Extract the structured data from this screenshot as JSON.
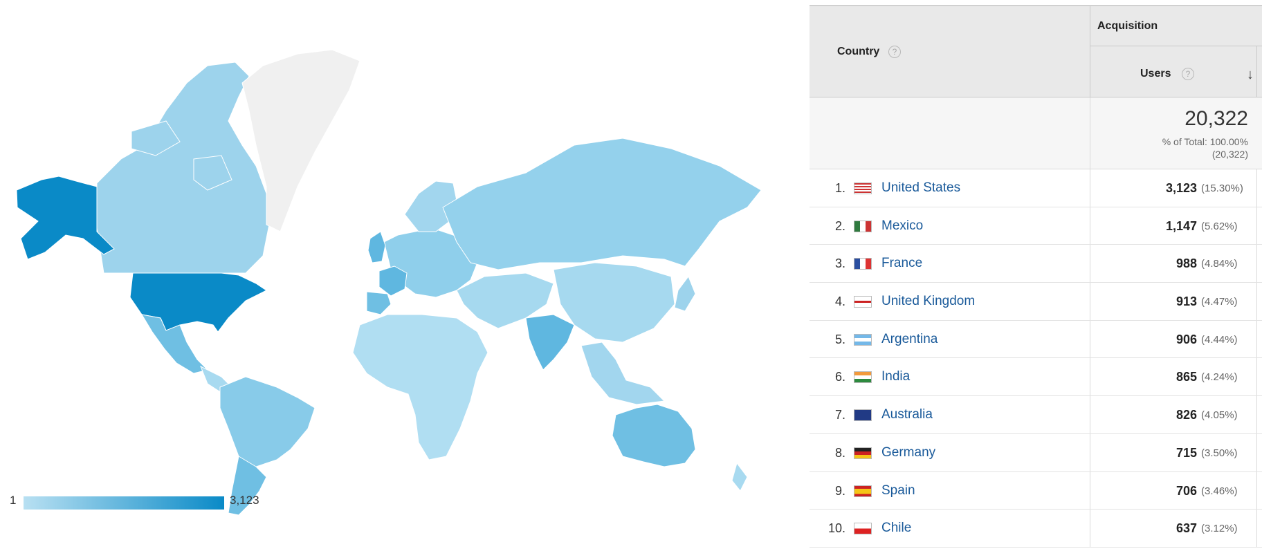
{
  "legend": {
    "min": "1",
    "max": "3,123",
    "color_low": "#b8e0f2",
    "color_high": "#0a8ac7"
  },
  "map_regions": [
    {
      "name": "Canada",
      "color": "#9dd3ec"
    },
    {
      "name": "Alaska",
      "color": "#0a8ac7"
    },
    {
      "name": "Greenland",
      "color": "#f0f0f0"
    },
    {
      "name": "United States",
      "color": "#0a8ac7"
    },
    {
      "name": "Mexico",
      "color": "#6fbfe3"
    },
    {
      "name": "Central America",
      "color": "#a8daf0"
    },
    {
      "name": "South America",
      "color": "#88cbe9"
    },
    {
      "name": "Argentina",
      "color": "#6fbfe3"
    },
    {
      "name": "Europe",
      "color": "#8fcfeb"
    },
    {
      "name": "France",
      "color": "#5fb7e0"
    },
    {
      "name": "United Kingdom",
      "color": "#5fb7e0"
    },
    {
      "name": "Spain",
      "color": "#6fbfe3"
    },
    {
      "name": "Scandinavia",
      "color": "#a2d6ee"
    },
    {
      "name": "Russia",
      "color": "#94d1ec"
    },
    {
      "name": "Africa",
      "color": "#b0def2"
    },
    {
      "name": "Middle East",
      "color": "#a6d9ef"
    },
    {
      "name": "India",
      "color": "#5fb7e0"
    },
    {
      "name": "China",
      "color": "#a6d9ef"
    },
    {
      "name": "Southeast Asia",
      "color": "#a2d6ee"
    },
    {
      "name": "Japan",
      "color": "#9dd3ec"
    },
    {
      "name": "Australia",
      "color": "#6fbfe3"
    },
    {
      "name": "New Zealand",
      "color": "#a8daf0"
    }
  ],
  "table": {
    "country_header": "Country",
    "help_glyph": "?",
    "group_header": "Acquisition",
    "users_header": "Users",
    "sort_icon": "↓",
    "total_value": "20,322",
    "total_pct": "% of Total: 100.00%",
    "total_abs": "(20,322)",
    "rows": [
      {
        "rank": "1.",
        "country": "United States",
        "users": "3,123",
        "pct": "(15.30%)",
        "flag": "us"
      },
      {
        "rank": "2.",
        "country": "Mexico",
        "users": "1,147",
        "pct": "(5.62%)",
        "flag": "mx"
      },
      {
        "rank": "3.",
        "country": "France",
        "users": "988",
        "pct": "(4.84%)",
        "flag": "fr"
      },
      {
        "rank": "4.",
        "country": "United Kingdom",
        "users": "913",
        "pct": "(4.47%)",
        "flag": "gb"
      },
      {
        "rank": "5.",
        "country": "Argentina",
        "users": "906",
        "pct": "(4.44%)",
        "flag": "ar"
      },
      {
        "rank": "6.",
        "country": "India",
        "users": "865",
        "pct": "(4.24%)",
        "flag": "in"
      },
      {
        "rank": "7.",
        "country": "Australia",
        "users": "826",
        "pct": "(4.05%)",
        "flag": "au"
      },
      {
        "rank": "8.",
        "country": "Germany",
        "users": "715",
        "pct": "(3.50%)",
        "flag": "de"
      },
      {
        "rank": "9.",
        "country": "Spain",
        "users": "706",
        "pct": "(3.46%)",
        "flag": "es"
      },
      {
        "rank": "10.",
        "country": "Chile",
        "users": "637",
        "pct": "(3.12%)",
        "flag": "cl"
      }
    ]
  }
}
